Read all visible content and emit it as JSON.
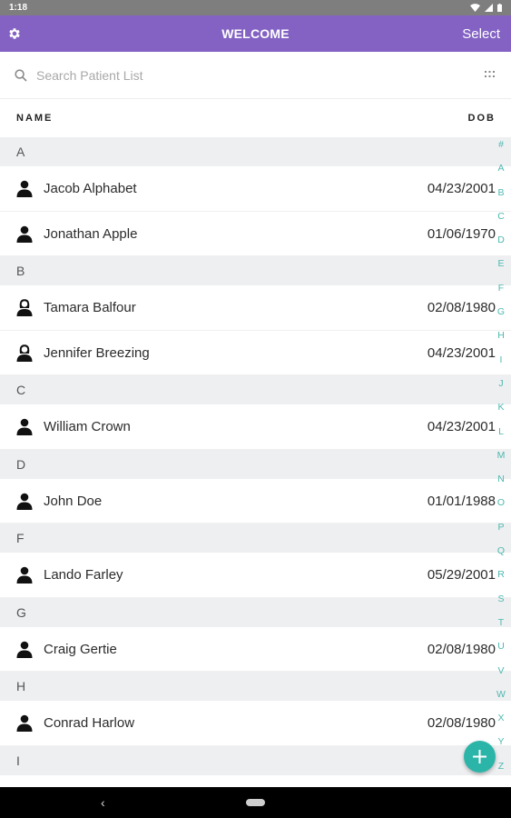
{
  "status_bar": {
    "time": "1:18"
  },
  "app_bar": {
    "title": "WELCOME",
    "select_label": "Select"
  },
  "search": {
    "placeholder": "Search Patient List",
    "value": ""
  },
  "columns": {
    "name": "NAME",
    "dob": "DOB"
  },
  "sections": [
    {
      "letter": "A",
      "patients": [
        {
          "name": "Jacob Alphabet",
          "dob": "04/23/2001",
          "icon": "person-male-icon"
        },
        {
          "name": "Jonathan Apple",
          "dob": "01/06/1970",
          "icon": "person-male-icon"
        }
      ]
    },
    {
      "letter": "B",
      "patients": [
        {
          "name": "Tamara Balfour",
          "dob": "02/08/1980",
          "icon": "person-female-icon"
        },
        {
          "name": "Jennifer Breezing",
          "dob": "04/23/2001",
          "icon": "person-female-icon"
        }
      ]
    },
    {
      "letter": "C",
      "patients": [
        {
          "name": "William Crown",
          "dob": "04/23/2001",
          "icon": "person-male-icon"
        }
      ]
    },
    {
      "letter": "D",
      "patients": [
        {
          "name": "John Doe",
          "dob": "01/01/1988",
          "icon": "person-male-icon"
        }
      ]
    },
    {
      "letter": "F",
      "patients": [
        {
          "name": "Lando Farley",
          "dob": "05/29/2001",
          "icon": "person-male-icon"
        }
      ]
    },
    {
      "letter": "G",
      "patients": [
        {
          "name": "Craig Gertie",
          "dob": "02/08/1980",
          "icon": "person-male-icon"
        }
      ]
    },
    {
      "letter": "H",
      "patients": [
        {
          "name": "Conrad Harlow",
          "dob": "02/08/1980",
          "icon": "person-male-icon"
        }
      ]
    },
    {
      "letter": "I",
      "patients": []
    }
  ],
  "alphabet_index": [
    "#",
    "A",
    "B",
    "C",
    "D",
    "E",
    "F",
    "G",
    "H",
    "I",
    "J",
    "K",
    "L",
    "M",
    "N",
    "O",
    "P",
    "Q",
    "R",
    "S",
    "T",
    "U",
    "V",
    "W",
    "X",
    "Y",
    "Z"
  ],
  "colors": {
    "app_bar": "#8362c3",
    "accent": "#2bb5a9",
    "index": "#4db8b0",
    "section_bg": "#eeeff1"
  }
}
